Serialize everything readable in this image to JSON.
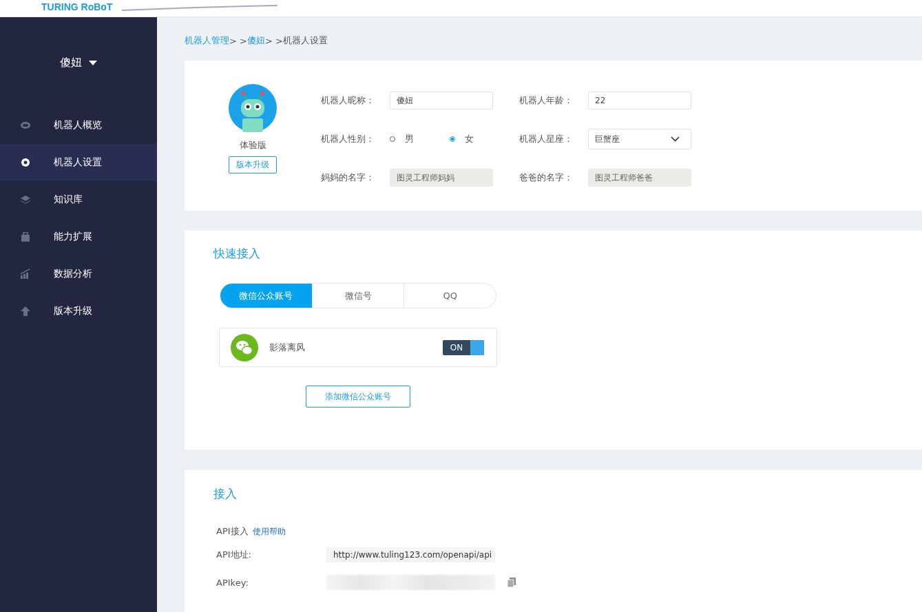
{
  "header": {
    "logo": "TURING RoBoT"
  },
  "sidebar": {
    "robot_name": "傻妞",
    "items": [
      {
        "label": "机器人概览",
        "kind": "eye",
        "selected": false
      },
      {
        "label": "机器人设置",
        "kind": "gear",
        "selected": true
      },
      {
        "label": "知识库",
        "kind": "layers",
        "selected": false
      },
      {
        "label": "能力扩展",
        "kind": "bag",
        "selected": false
      },
      {
        "label": "数据分析",
        "kind": "chart",
        "selected": false
      },
      {
        "label": "版本升级",
        "kind": "arrow",
        "selected": false
      }
    ]
  },
  "breadcrumb": [
    {
      "text": "机器人管理",
      "kind": "link"
    },
    {
      "text": "> >",
      "kind": "sep"
    },
    {
      "text": "傻妞",
      "kind": "link"
    },
    {
      "text": "> >",
      "kind": "sep"
    },
    {
      "text": "机器人设置",
      "kind": "current"
    }
  ],
  "profile": {
    "edition": "体验版",
    "upgrade_button": "版本升级",
    "fields": [
      {
        "label": "机器人昵称：",
        "kind": "input",
        "value": "傻妞"
      },
      {
        "label": "机器人年龄：",
        "kind": "input",
        "value": "22"
      },
      {
        "label": "机器人性别：",
        "kind": "radio",
        "options": [
          {
            "label": "男",
            "selected": false
          },
          {
            "label": "女",
            "selected": true
          }
        ]
      },
      {
        "label": "机器人星座：",
        "kind": "select",
        "value": "巨蟹座"
      },
      {
        "label": "妈妈的名字：",
        "kind": "readonly",
        "value": "图灵工程师妈妈"
      },
      {
        "label": "爸爸的名字：",
        "kind": "readonly",
        "value": "图灵工程师爸爸"
      }
    ]
  },
  "quick_access": {
    "title": "快速接入",
    "tabs": [
      {
        "label": "微信公众账号",
        "selected": true
      },
      {
        "label": "微信号",
        "selected": false
      },
      {
        "label": "QQ",
        "selected": false
      }
    ],
    "accounts": [
      {
        "name": "影落离风",
        "toggle_label": "ON",
        "on": true
      }
    ],
    "add_button": "添加微信公众账号"
  },
  "access": {
    "title": "接入",
    "api_label": "API接入",
    "help_link": "使用帮助",
    "address_label": "API地址:",
    "address": "http://www.tuling123.com/openapi/api",
    "key_label": "APIkey:"
  }
}
